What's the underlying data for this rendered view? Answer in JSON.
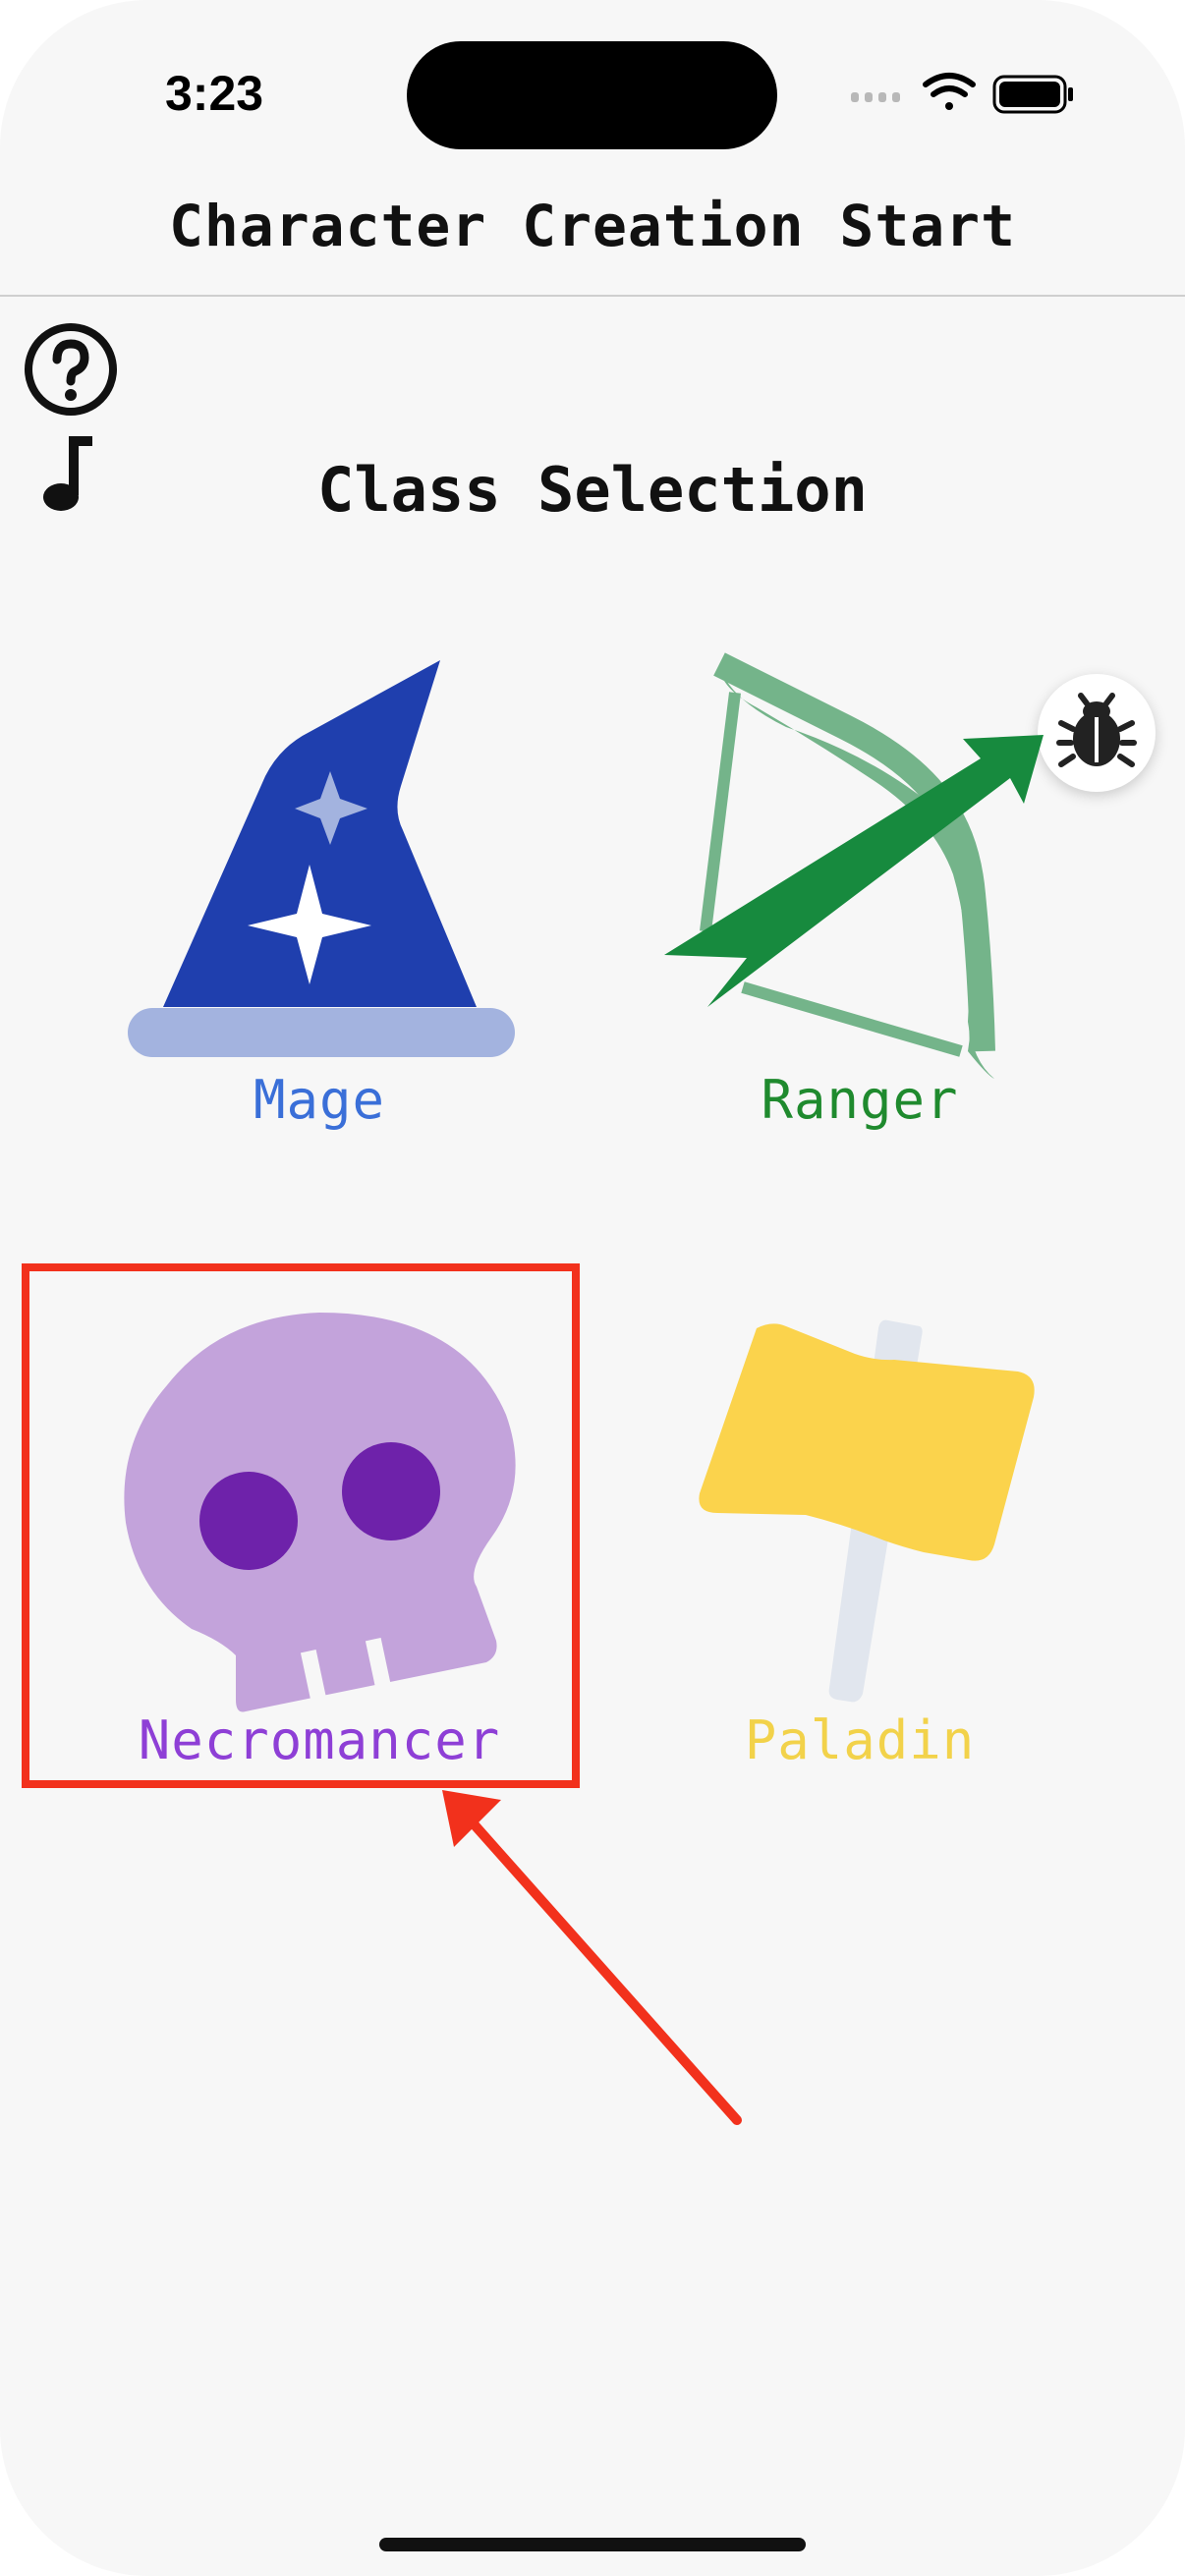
{
  "status_bar": {
    "time": "3:23"
  },
  "nav": {
    "title": "Character Creation Start"
  },
  "screen": {
    "section_title": "Class Selection"
  },
  "classes": [
    {
      "label": "Mage",
      "color": "#3a6fd8",
      "icon": "wizard-hat-icon"
    },
    {
      "label": "Ranger",
      "color": "#1f8a2e",
      "icon": "bow-icon"
    },
    {
      "label": "Necromancer",
      "color": "#8e3fd6",
      "icon": "skull-icon"
    },
    {
      "label": "Paladin",
      "color": "#f2d24a",
      "icon": "hammer-icon"
    }
  ],
  "colors": {
    "background": "#f7f7f7",
    "annotation_red": "#f2311c",
    "annotation_green": "#178a3e"
  },
  "icons": {
    "help": "question-circle-icon",
    "music": "music-note-icon",
    "debug": "bug-icon"
  }
}
